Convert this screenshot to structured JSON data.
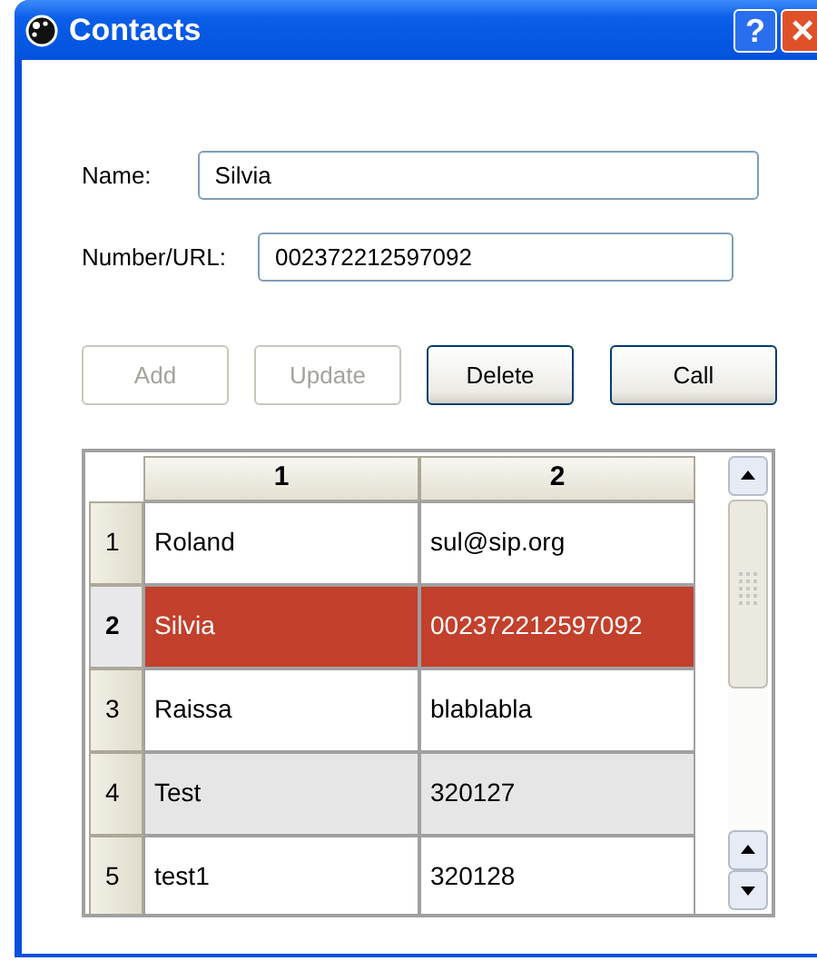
{
  "window": {
    "title": "Contacts",
    "help_button": "?",
    "close_button": "×"
  },
  "fields": [
    {
      "label": "Name:",
      "value": "Silvia"
    },
    {
      "label": "Number/URL:",
      "value": "002372212597092"
    }
  ],
  "buttons": [
    {
      "label": "Add",
      "disabled": true
    },
    {
      "label": "Update",
      "disabled": true
    },
    {
      "label": "Delete",
      "disabled": false
    },
    {
      "label": "Call",
      "disabled": false
    }
  ],
  "table": {
    "columns": [
      "1",
      "2"
    ],
    "rows": [
      {
        "number": "1",
        "cells": [
          "Roland",
          "sul@sip.org"
        ],
        "selected": false,
        "shaded": false
      },
      {
        "number": "2",
        "cells": [
          "Silvia",
          "002372212597092"
        ],
        "selected": true,
        "shaded": false
      },
      {
        "number": "3",
        "cells": [
          "Raissa",
          "blablabla"
        ],
        "selected": false,
        "shaded": false
      },
      {
        "number": "4",
        "cells": [
          "Test",
          "320127"
        ],
        "selected": false,
        "shaded": true
      },
      {
        "number": "5",
        "cells": [
          "test1",
          "320128"
        ],
        "selected": false,
        "shaded": false
      }
    ]
  }
}
